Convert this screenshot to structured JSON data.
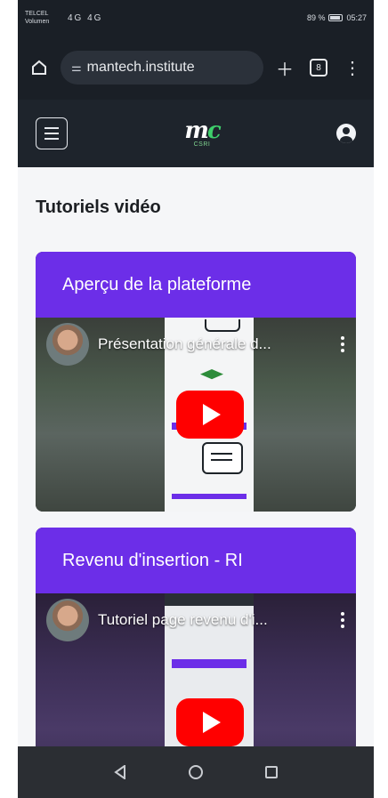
{
  "status_bar": {
    "carrier_line1": "TELCEL",
    "carrier_line2": "Volumen",
    "signal": "4G 4G",
    "battery": "89 %",
    "time": "05:27"
  },
  "browser": {
    "url": "mantech.institute",
    "tab_count": "8"
  },
  "site": {
    "logo_text": "CSRI"
  },
  "page": {
    "title": "Tutoriels vidéo"
  },
  "cards": [
    {
      "header": "Aperçu de la plateforme",
      "video_title": "Présentation générale d..."
    },
    {
      "header": "Revenu d'insertion - RI",
      "video_title": "Tutoriel page revenu d'i..."
    }
  ]
}
